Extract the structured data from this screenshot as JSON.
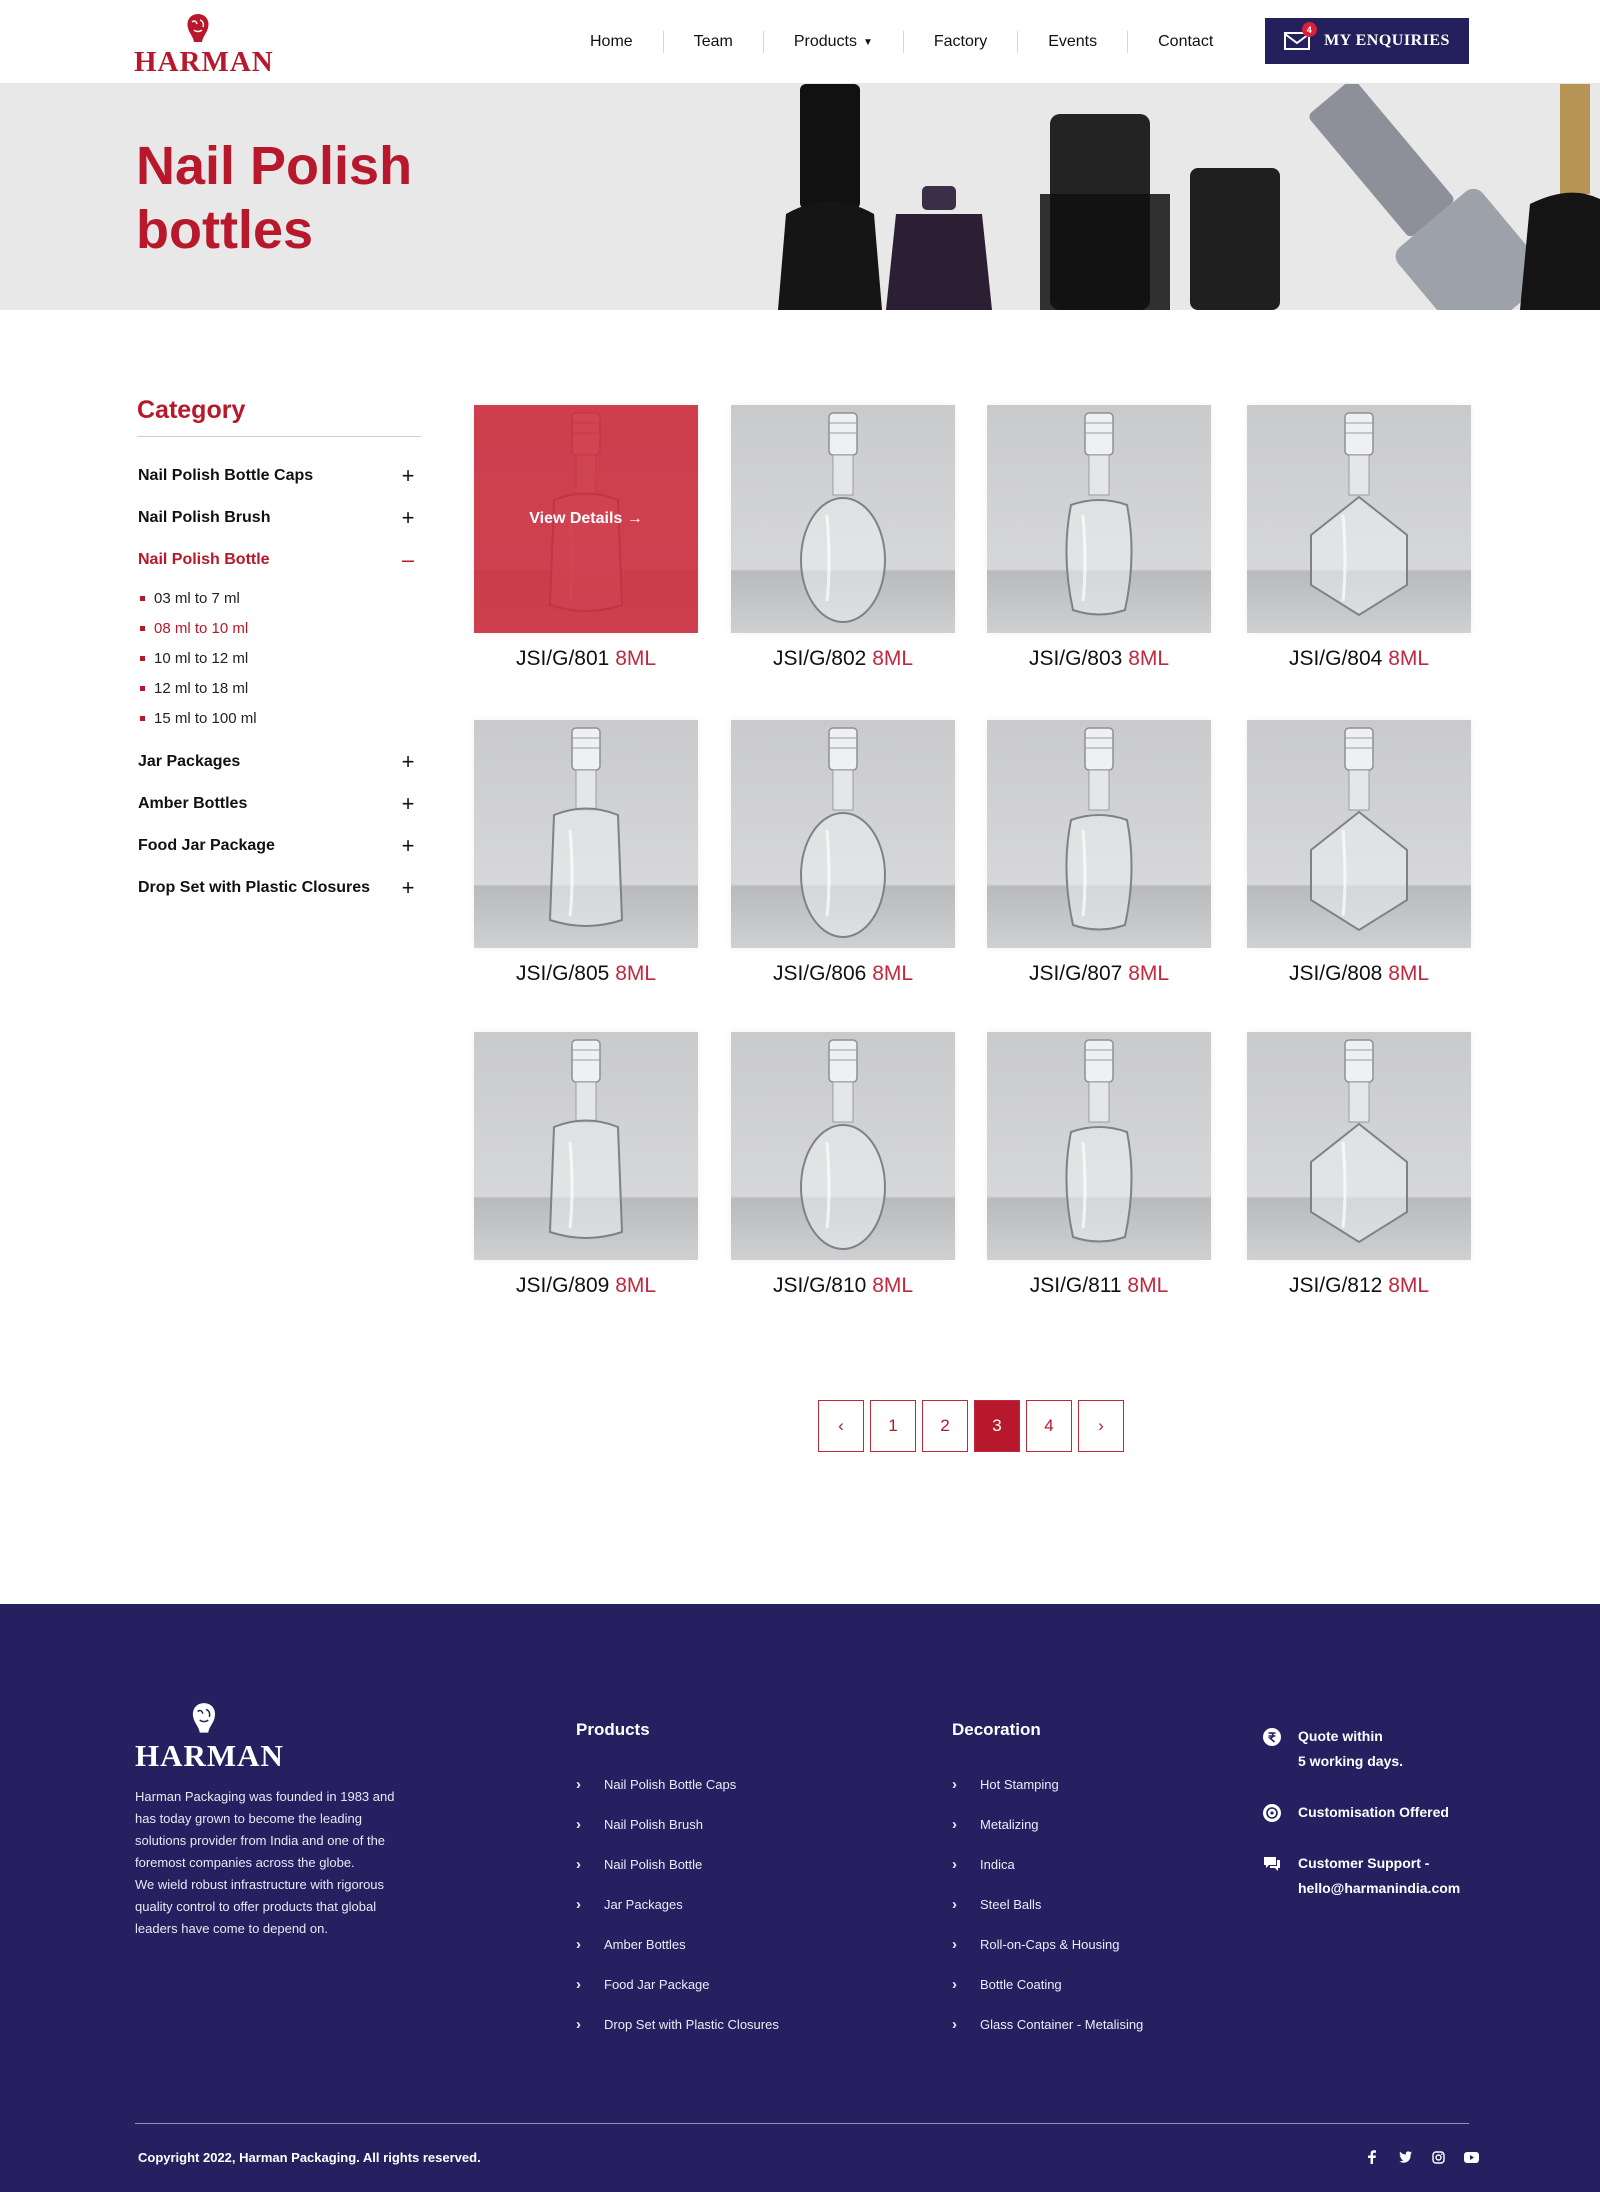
{
  "brand": {
    "name": "HARMAN",
    "accent": "#b8182b",
    "navy": "#262061"
  },
  "nav": {
    "items": [
      {
        "label": "Home"
      },
      {
        "label": "Team"
      },
      {
        "label": "Products"
      },
      {
        "label": "Factory"
      },
      {
        "label": "Events"
      },
      {
        "label": "Contact"
      }
    ],
    "enquiries_label": "MY ENQUIRIES",
    "enquiries_count": "4"
  },
  "banner": {
    "title": "Nail Polish bottles"
  },
  "sidebar": {
    "title": "Category",
    "categories": [
      {
        "label": "Nail Polish Bottle Caps",
        "icon": "plus-icon"
      },
      {
        "label": "Nail Polish Brush",
        "icon": "plus-icon"
      },
      {
        "label": "Nail Polish Bottle",
        "icon": "minus-icon",
        "expanded": true,
        "subs": [
          "03 ml to 7 ml",
          "08 ml to 10 ml",
          "10 ml to 12 ml",
          "12 ml to 18 ml",
          "15 ml to 100 ml"
        ],
        "active_sub": "08 ml to 10 ml"
      },
      {
        "label": "Jar Packages",
        "icon": "plus-icon"
      },
      {
        "label": "Amber Bottles",
        "icon": "plus-icon"
      },
      {
        "label": "Food Jar Package",
        "icon": "plus-icon"
      },
      {
        "label": "Drop Set with Plastic Closures",
        "icon": "plus-icon"
      }
    ]
  },
  "products": {
    "hover_label": "View Details →",
    "items": [
      {
        "code": "JSI/G/801",
        "size": "8ML"
      },
      {
        "code": "JSI/G/802",
        "size": "8ML"
      },
      {
        "code": "JSI/G/803",
        "size": "8ML"
      },
      {
        "code": "JSI/G/804",
        "size": "8ML"
      },
      {
        "code": "JSI/G/805",
        "size": "8ML"
      },
      {
        "code": "JSI/G/806",
        "size": "8ML"
      },
      {
        "code": "JSI/G/807",
        "size": "8ML"
      },
      {
        "code": "JSI/G/808",
        "size": "8ML"
      },
      {
        "code": "JSI/G/809",
        "size": "8ML"
      },
      {
        "code": "JSI/G/810",
        "size": "8ML"
      },
      {
        "code": "JSI/G/811",
        "size": "8ML"
      },
      {
        "code": "JSI/G/812",
        "size": "8ML"
      }
    ]
  },
  "pagination": {
    "prev": "‹",
    "next": "›",
    "pages": [
      "1",
      "2",
      "3",
      "4"
    ],
    "current": "3"
  },
  "footer": {
    "brand": "HARMAN",
    "about": "Harman Packaging was founded in 1983 and\n has today grown to become the leading\n solutions provider from India and one of the\n foremost companies across the globe.\nWe wield robust infrastructure with rigorous\n quality control to offer products that global\n leaders have come to depend on.",
    "products_title": "Products",
    "products_links": [
      "Nail Polish Bottle Caps",
      "Nail Polish Brush",
      "Nail Polish Bottle",
      "Jar Packages",
      "Amber Bottles",
      "Food Jar Package",
      "Drop Set with Plastic Closures"
    ],
    "decoration_title": "Decoration",
    "decoration_links": [
      "Hot Stamping",
      "Metalizing",
      "Indica",
      "Steel Balls",
      "Roll-on-Caps & Housing",
      "Bottle Coating",
      "Glass Container - Metalising"
    ],
    "info": [
      {
        "icon": "rupee-icon",
        "text": "Quote within\n5 working days."
      },
      {
        "icon": "customise-icon",
        "text": "Customisation Offered"
      },
      {
        "icon": "chat-support-icon",
        "text": "Customer Support -\nhello@harmanindia.com"
      }
    ],
    "copyright": "Copyright 2022, Harman Packaging. All rights reserved.",
    "social": [
      "facebook-icon",
      "twitter-icon",
      "instagram-icon",
      "youtube-icon"
    ]
  }
}
